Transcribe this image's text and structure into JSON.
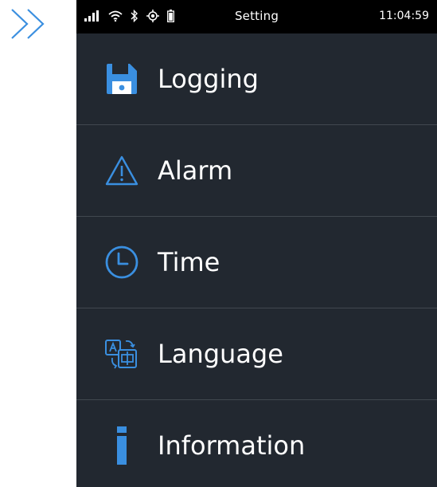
{
  "nav": {
    "back_icon": "double-chevron-right-icon"
  },
  "status_bar": {
    "title": "Setting",
    "time": "11:04:59",
    "icons": [
      "signal-icon",
      "wifi-icon",
      "bluetooth-icon",
      "location-icon",
      "battery-icon"
    ]
  },
  "colors": {
    "accent": "#3a8fe0",
    "background": "#222830",
    "status_bar": "#000000",
    "divider": "#41484f",
    "text": "#ffffff"
  },
  "menu": {
    "items": [
      {
        "label": "Logging",
        "icon": "floppy-disk-icon"
      },
      {
        "label": "Alarm",
        "icon": "warning-triangle-icon"
      },
      {
        "label": "Time",
        "icon": "clock-icon"
      },
      {
        "label": "Language",
        "icon": "translate-icon"
      },
      {
        "label": "Information",
        "icon": "info-icon"
      }
    ]
  }
}
